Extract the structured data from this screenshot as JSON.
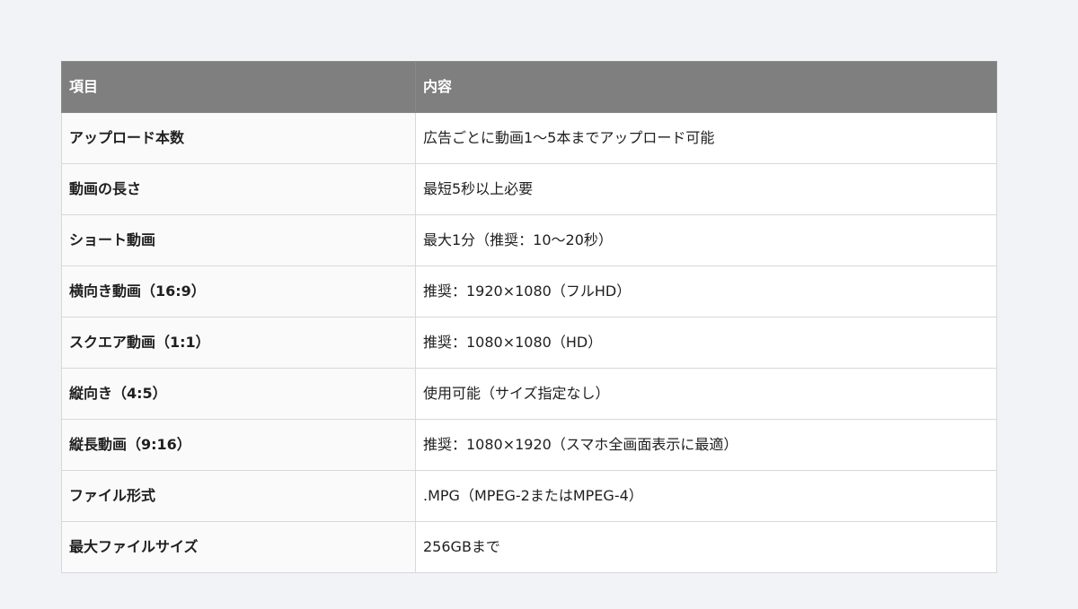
{
  "table": {
    "headers": [
      "項目",
      "内容"
    ],
    "rows": [
      [
        "アップロード本数",
        "広告ごとに動画1〜5本までアップロード可能"
      ],
      [
        "動画の長さ",
        "最短5秒以上必要"
      ],
      [
        "ショート動画",
        "最大1分（推奨：10〜20秒）"
      ],
      [
        "横向き動画（16:9）",
        "推奨：1920×1080（フルHD）"
      ],
      [
        "スクエア動画（1:1）",
        "推奨：1080×1080（HD）"
      ],
      [
        "縦向き（4:5）",
        "使用可能（サイズ指定なし）"
      ],
      [
        "縦長動画（9:16）",
        "推奨：1080×1920（スマホ全画面表示に最適）"
      ],
      [
        "ファイル形式",
        ".MPG（MPEG-2またはMPEG-4）"
      ],
      [
        "最大ファイルサイズ",
        "256GBまで"
      ]
    ]
  },
  "colors": {
    "page_background": "#f2f3f7",
    "header_background": "#7f7f7f",
    "header_text": "#ffffff",
    "border": "#d8d8d8"
  }
}
